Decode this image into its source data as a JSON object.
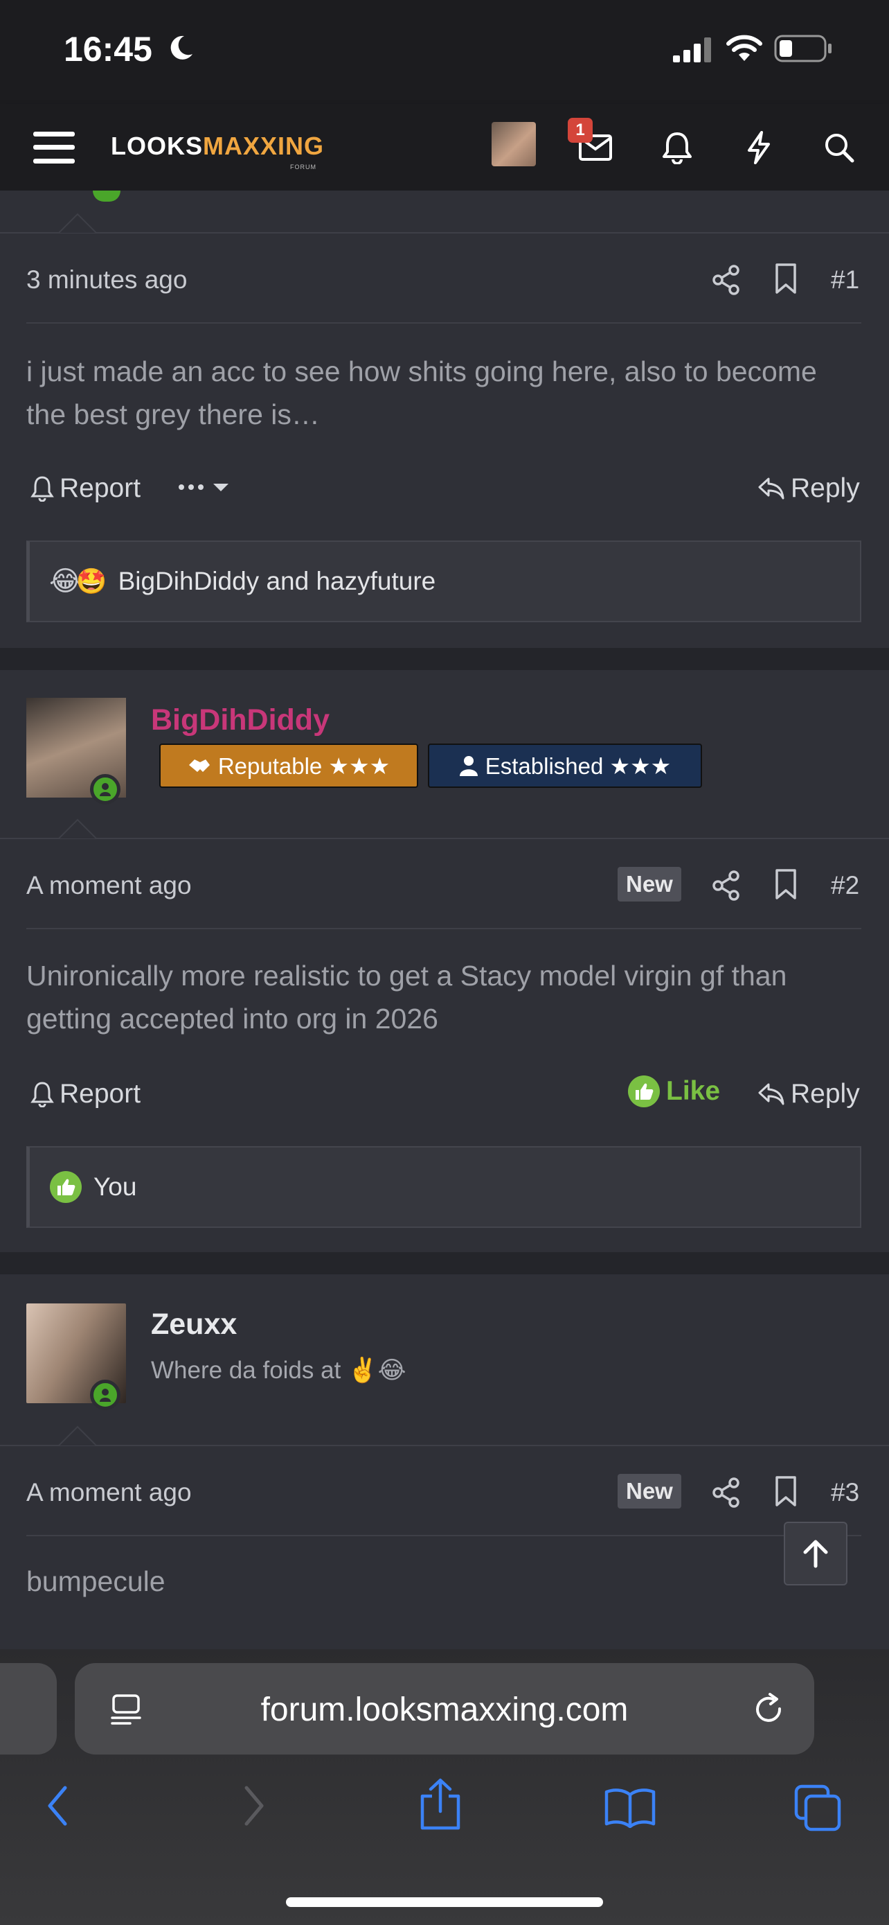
{
  "status_bar": {
    "time": "16:45"
  },
  "header": {
    "logo_part1": "LOOKS",
    "logo_part2": "MAXXING",
    "logo_sub": "FORUM",
    "inbox_badge": "1"
  },
  "posts": [
    {
      "timestamp": "3 minutes ago",
      "number": "#1",
      "body": "i just made an acc to see how shits going here, also to become the best grey there is…",
      "report_label": "Report",
      "reply_label": "Reply",
      "reactions": "BigDihDiddy and hazyfuture"
    },
    {
      "username": "BigDihDiddy",
      "badge1": "Reputable ★★★",
      "badge2": "Established ★★★",
      "timestamp": "A moment ago",
      "new_label": "New",
      "number": "#2",
      "body": "Unironically more realistic to get a Stacy model virgin gf than getting accepted into org in 2026",
      "report_label": "Report",
      "like_label": "Like",
      "reply_label": "Reply",
      "reactions": "You"
    },
    {
      "username": "Zeuxx",
      "user_title": "Where da foids at ✌️😂",
      "timestamp": "A moment ago",
      "new_label": "New",
      "number": "#3",
      "body": "bumpecule"
    }
  ],
  "browser": {
    "url": "forum.looksmaxxing.com"
  },
  "colors": {
    "accent": "#f0a640",
    "username_pink": "#c83779",
    "like_green": "#7ac043",
    "online": "#4aa62a"
  }
}
